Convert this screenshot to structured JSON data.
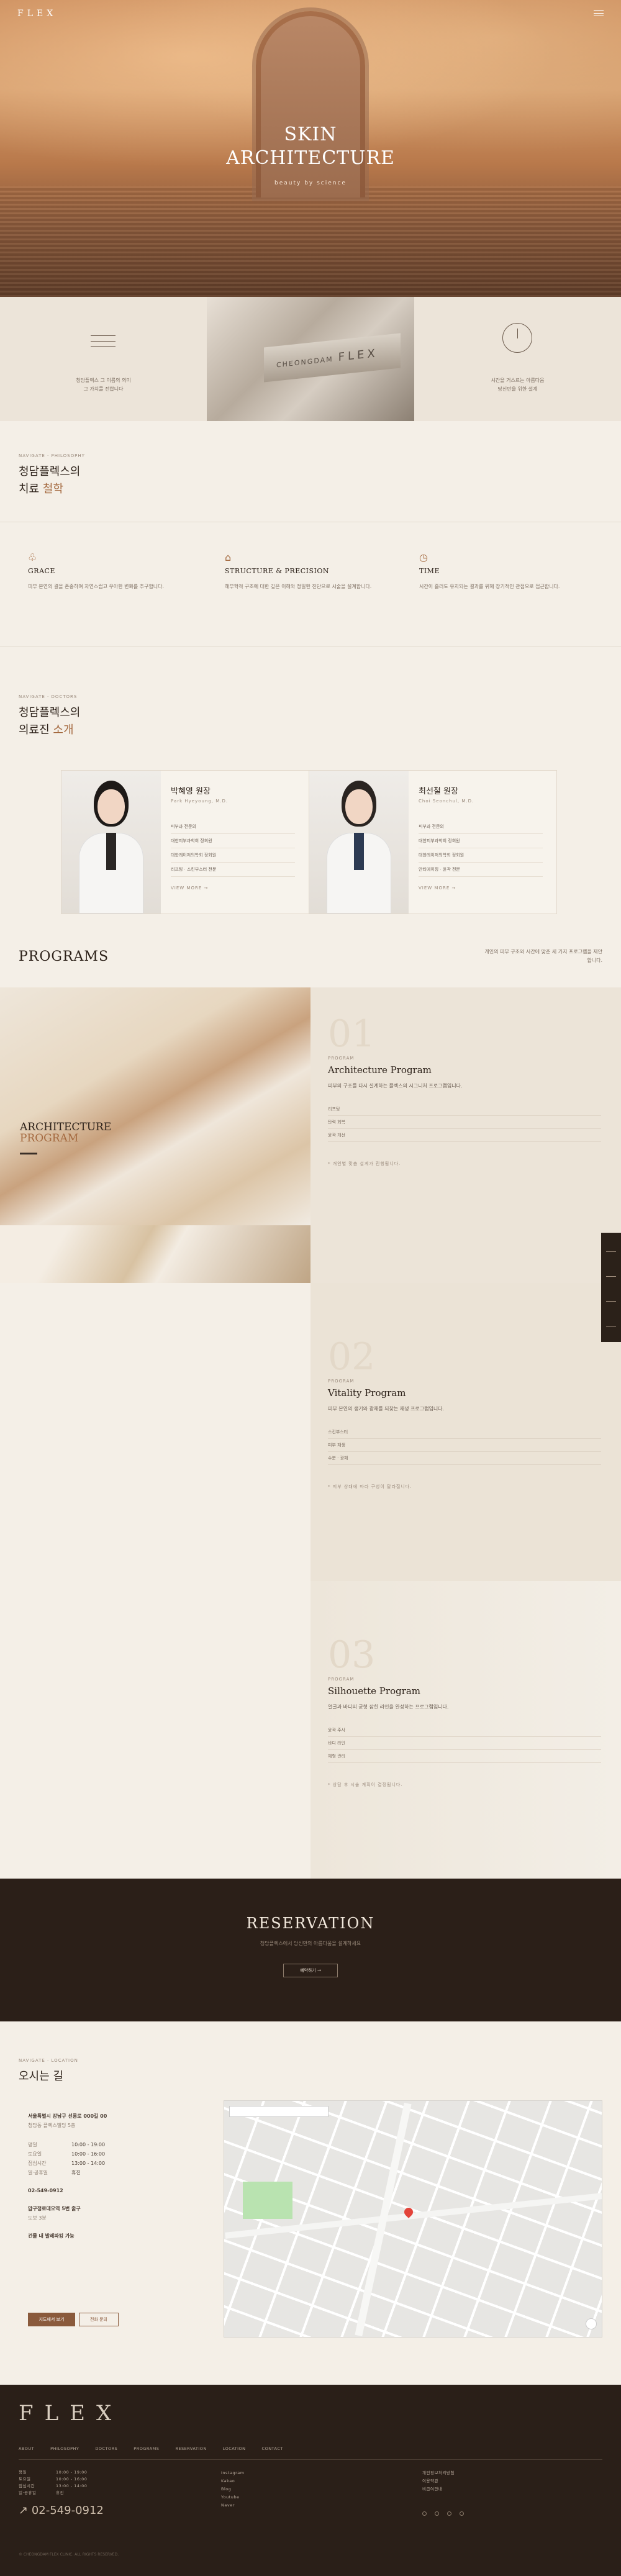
{
  "header": {
    "logo": "FLEX"
  },
  "hero": {
    "title_line1": "SKIN",
    "title_line2": "ARCHITECTURE",
    "subtitle": "beauty by science"
  },
  "intro": {
    "left_text": "청담플렉스 그 이름의 의미\n그 가치를 전합니다",
    "plate_text": "CHEONGDAM",
    "plate_brand": "FLEX",
    "right_text": "시간을 거스르는 아름다움\n당신만을 위한 설계"
  },
  "philosophy": {
    "label": "NAVIGATE · PHILOSOPHY",
    "title_a": "청담플렉스의",
    "title_b": "치료 ",
    "title_accent": "철학",
    "items": [
      {
        "icon": "leaf-icon",
        "glyph": "♧",
        "title": "GRACE",
        "text": "피부 본연의 결을 존중하며 자연스럽고 우아한 변화를 추구합니다."
      },
      {
        "icon": "structure-icon",
        "glyph": "⌂",
        "title": "STRUCTURE & PRECISION",
        "text": "해부학적 구조에 대한 깊은 이해와 정밀한 진단으로 시술을 설계합니다."
      },
      {
        "icon": "clock-icon",
        "glyph": "◷",
        "title": "TIME",
        "text": "시간이 흘러도 유지되는 결과를 위해 장기적인 관점으로 접근합니다."
      }
    ]
  },
  "doctors": {
    "label": "NAVIGATE · DOCTORS",
    "title_a": "청담플렉스의",
    "title_b": "의료진 ",
    "title_accent": "소개",
    "list": [
      {
        "name": "박혜영 원장",
        "en": "Park Hyeyoung, M.D.",
        "items": [
          "피부과 전문의",
          "대한피부과학회 정회원",
          "대한레이저의학회 정회원",
          "리프팅 · 스킨부스터 전문"
        ]
      },
      {
        "name": "최선철 원장",
        "en": "Choi Seonchul, M.D.",
        "items": [
          "피부과 전문의",
          "대한피부과학회 정회원",
          "대한레이저의학회 정회원",
          "안티에이징 · 윤곽 전문"
        ]
      }
    ]
  },
  "programs": {
    "title": "PROGRAMS",
    "desc": "개인의 피부 구조와 시간에 맞춘 세 가지 프로그램을 제안합니다.",
    "list": [
      {
        "num": "01",
        "label": "PROGRAM",
        "name": "Architecture Program",
        "desc": "피부의 구조를 다시 설계하는 플렉스의 시그니처 프로그램입니다.",
        "items": [
          "리프팅",
          "탄력 회복",
          "윤곽 개선"
        ],
        "note": "* 개인별 맞춤 설계가 진행됩니다."
      },
      {
        "num": "02",
        "label": "PROGRAM",
        "name": "Vitality Program",
        "desc": "피부 본연의 생기와 광채를 되찾는 재생 프로그램입니다.",
        "items": [
          "스킨부스터",
          "피부 재생",
          "수분 · 광채"
        ],
        "note": "* 피부 상태에 따라 구성이 달라집니다."
      },
      {
        "num": "03",
        "label": "PROGRAM",
        "name": "Silhouette Program",
        "desc": "얼굴과 바디의 균형 잡힌 라인을 완성하는 프로그램입니다.",
        "items": [
          "윤곽 주사",
          "바디 라인",
          "체형 관리"
        ],
        "note": "* 상담 후 시술 계획이 결정됩니다."
      }
    ],
    "banner_title_a": "ARCHITECTURE",
    "banner_title_b": "PROGRAM"
  },
  "reservation": {
    "title": "RESERVATION",
    "sub": "청담플렉스에서 당신만의 아름다움을 설계하세요",
    "button": "예약하기 →"
  },
  "location": {
    "label": "NAVIGATE · LOCATION",
    "title": "오시는 길",
    "address": "서울특별시 강남구 선릉로 000길 00",
    "address_sub": "청담동 플렉스빌딩 5층",
    "hours": [
      [
        "평일",
        "10:00 - 19:00"
      ],
      [
        "토요일",
        "10:00 - 16:00"
      ],
      [
        "점심시간",
        "13:00 - 14:00"
      ],
      [
        "일·공휴일",
        "휴진"
      ]
    ],
    "phone": "02-549-0912",
    "subway": "압구정로데오역 5번 출구",
    "subway_sub": "도보 3분",
    "parking": "건물 내 발레파킹 가능",
    "btn_map": "지도에서 보기",
    "btn_call": "전화 문의"
  },
  "footer": {
    "logo": "FLEX",
    "nav": [
      "ABOUT",
      "PHILOSOPHY",
      "DOCTORS",
      "PROGRAMS",
      "RESERVATION",
      "LOCATION",
      "CONTACT"
    ],
    "phone": "02-549-0912",
    "copyright": "© CHEONGDAM FLEX CLINIC. ALL RIGHTS RESERVED.",
    "col2": [
      "Instagram",
      "Kakao",
      "Blog",
      "Youtube",
      "Naver"
    ],
    "col3": [
      "개인정보처리방침",
      "이용약관",
      "비급여안내"
    ]
  }
}
